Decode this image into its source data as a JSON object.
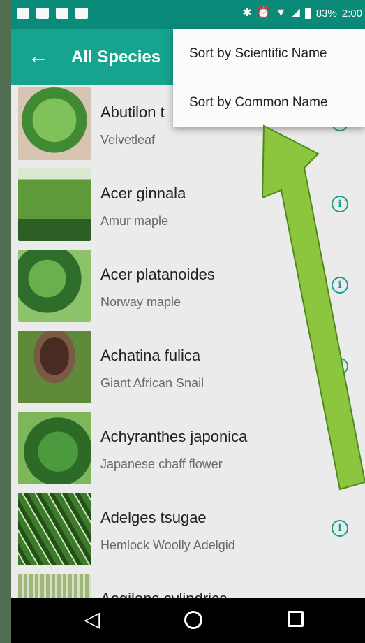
{
  "status_bar": {
    "battery": "83%",
    "time": "2:00"
  },
  "app_bar": {
    "back_icon": "arrow-left-icon",
    "title": "All Species"
  },
  "sort_menu": {
    "items": [
      "Sort by Scientific Name",
      "Sort by Common Name"
    ]
  },
  "species": [
    {
      "scientific": "Abutilon t",
      "common": "Velvetleaf"
    },
    {
      "scientific": "Acer ginnala",
      "common": "Amur maple"
    },
    {
      "scientific": "Acer platanoides",
      "common": "Norway maple"
    },
    {
      "scientific": "Achatina fulica",
      "common": "Giant African Snail"
    },
    {
      "scientific": "Achyranthes japonica",
      "common": "Japanese chaff flower"
    },
    {
      "scientific": "Adelges tsugae",
      "common": "Hemlock Woolly Adelgid"
    },
    {
      "scientific": "Aegilops cylindrica",
      "common": ""
    }
  ],
  "colors": {
    "status_bar": "#0a8a78",
    "app_bar": "#16a48f",
    "accent": "#1aa08c",
    "annotation_arrow": "#8cc63f"
  }
}
